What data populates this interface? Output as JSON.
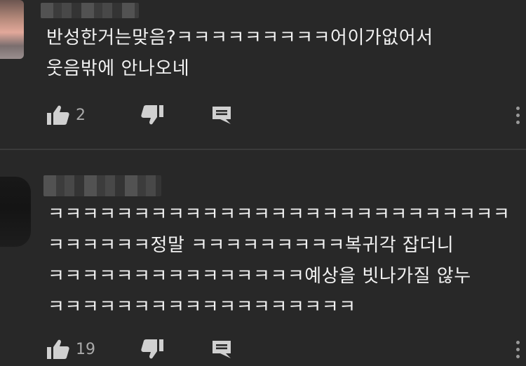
{
  "comments": [
    {
      "lines": [
        "반성한거는맞음?ㅋㅋㅋㅋㅋㅋㅋㅋㅋ어이가없어서",
        "웃음밖에 안나오네"
      ],
      "like_count": "2"
    },
    {
      "lines": [
        "ㅋㅋㅋㅋㅋㅋㅋㅋㅋㅋㅋㅋㅋㅋㅋㅋㅋㅋㅋㅋㅋㅋㅋㅋㅋㅋㅋ",
        "ㅋㅋㅋㅋㅋㅋ정말 ㅋㅋㅋㅋㅋㅋㅋㅋㅋ복귀각 잡더니",
        "ㅋㅋㅋㅋㅋㅋㅋㅋㅋㅋㅋㅋㅋㅋㅋ예상을 빗나가질 않누",
        "ㅋㅋㅋㅋㅋㅋㅋㅋㅋㅋㅋㅋㅋㅋㅋㅋㅋㅋ"
      ],
      "like_count": "19"
    }
  ],
  "icons": {
    "like": "thumb-up-icon",
    "dislike": "thumb-down-icon",
    "reply": "reply-comment-icon",
    "more": "more-vertical-icon"
  },
  "colors": {
    "background": "#282828",
    "text": "#f1f1f1",
    "secondary_text": "#aaaaaa",
    "icon": "#d0d0d0",
    "divider": "#3a3a3a"
  }
}
